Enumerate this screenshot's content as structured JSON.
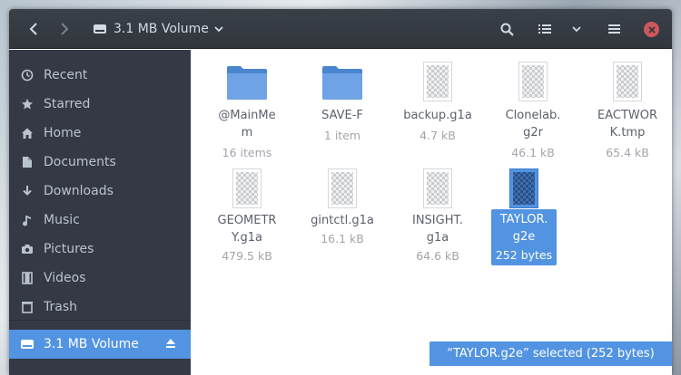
{
  "window": {
    "location_label": "3.1 MB Volume"
  },
  "header_icons": [
    "back-icon",
    "forward-icon",
    "drive-icon",
    "chevron-down-icon",
    "search-icon",
    "list-view-icon",
    "chevron-down-icon",
    "menu-icon",
    "close-icon"
  ],
  "sidebar": {
    "items": [
      {
        "label": "Recent",
        "icon": "clock-icon"
      },
      {
        "label": "Starred",
        "icon": "star-icon"
      },
      {
        "label": "Home",
        "icon": "home-icon"
      },
      {
        "label": "Documents",
        "icon": "document-icon"
      },
      {
        "label": "Downloads",
        "icon": "download-icon"
      },
      {
        "label": "Music",
        "icon": "music-icon"
      },
      {
        "label": "Pictures",
        "icon": "camera-icon"
      },
      {
        "label": "Videos",
        "icon": "film-icon"
      },
      {
        "label": "Trash",
        "icon": "trash-icon"
      }
    ],
    "volume": {
      "label": "3.1 MB Volume",
      "icon": "drive-icon",
      "eject_icon": "eject-icon"
    }
  },
  "files": [
    {
      "name": "@MainMe\nm",
      "info": "16 items",
      "type": "folder"
    },
    {
      "name": "SAVE-F",
      "info": "1 item",
      "type": "folder"
    },
    {
      "name": "backup.g1a",
      "info": "4.7 kB",
      "type": "file"
    },
    {
      "name": "Clonelab.\ng2r",
      "info": "46.1 kB",
      "type": "file"
    },
    {
      "name": "EACTWOR\nK.tmp",
      "info": "65.4 kB",
      "type": "file"
    },
    {
      "name": "GEOMETR\nY.g1a",
      "info": "479.5 kB",
      "type": "file"
    },
    {
      "name": "gintctl.g1a",
      "info": "16.1 kB",
      "type": "file"
    },
    {
      "name": "INSIGHT.\ng1a",
      "info": "64.6 kB",
      "type": "file"
    },
    {
      "name": "TAYLOR.\ng2e",
      "info": "252 bytes",
      "type": "file",
      "selected": true
    }
  ],
  "statusbar": {
    "text": "“TAYLOR.g2e” selected  (252 bytes)"
  },
  "colors": {
    "accent": "#5294e2",
    "sidebar_bg": "#353945",
    "header_bg": "#31363d",
    "close": "#cc575d"
  }
}
